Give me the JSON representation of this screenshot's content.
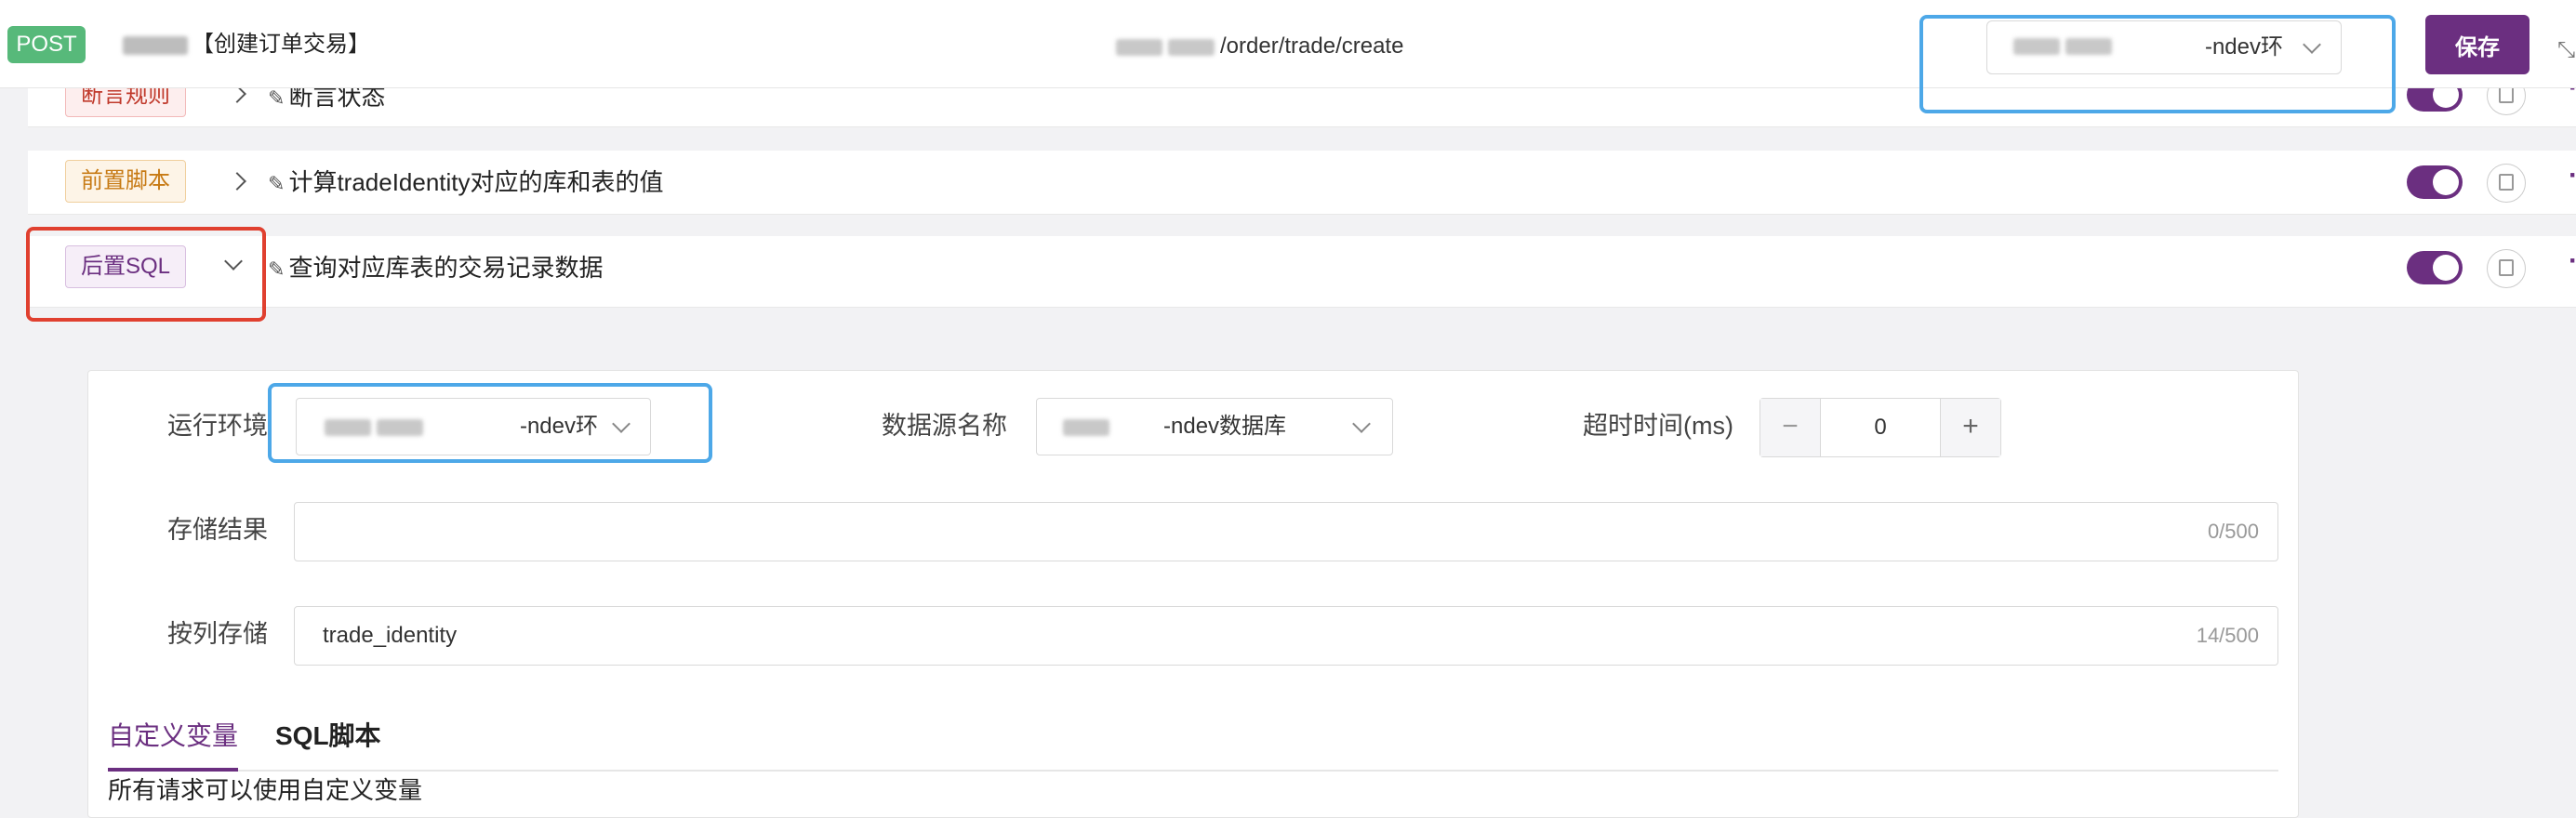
{
  "header": {
    "method": "POST",
    "title": "【创建订单交易】",
    "url": "/order/trade/create",
    "env_value": "-ndev环",
    "save_label": "保存"
  },
  "steps": [
    {
      "tag": "断言规则",
      "title": "断言状态"
    },
    {
      "tag": "前置脚本",
      "title": "计算tradeIdentity对应的库和表的值"
    },
    {
      "tag": "后置SQL",
      "title": "查询对应库表的交易记录数据"
    }
  ],
  "post_sql": {
    "run_env_label": "运行环境",
    "run_env_value": "-ndev环",
    "datasource_label": "数据源名称",
    "datasource_value": "-ndev数据库",
    "timeout_label": "超时时间(ms)",
    "timeout_value": "0",
    "minus_symbol": "−",
    "plus_symbol": "+",
    "store_result_label": "存储结果",
    "store_result_value": "",
    "store_result_count": "0/500",
    "store_column_label": "按列存储",
    "store_column_value": "trade_identity",
    "store_column_count": "14/500",
    "tabs": [
      "自定义变量",
      "SQL脚本"
    ],
    "hint": "所有请求可以使用自定义变量"
  },
  "colors": {
    "accent": "#6b2f80",
    "method_bg": "#57b97a",
    "highlight_blue": "#4da8e8",
    "highlight_red": "#e0402f"
  }
}
